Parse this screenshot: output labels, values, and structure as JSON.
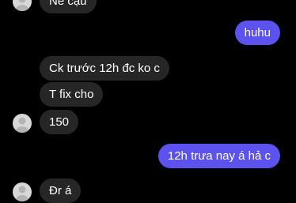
{
  "colors": {
    "background": "#000000",
    "incoming_bubble": "#262626",
    "outgoing_bubble": "#5b52f0",
    "avatar": "#d8d8d8"
  },
  "messages": [
    {
      "sender": "other",
      "text": "Nè cậu"
    },
    {
      "sender": "me",
      "text": "huhu"
    },
    {
      "sender": "other",
      "text": "Ck trước 12h đc ko c"
    },
    {
      "sender": "other",
      "text": "T fix cho"
    },
    {
      "sender": "other",
      "text": "150"
    },
    {
      "sender": "me",
      "text": "12h trưa nay á hả c"
    },
    {
      "sender": "other",
      "text": "Đr á"
    }
  ]
}
